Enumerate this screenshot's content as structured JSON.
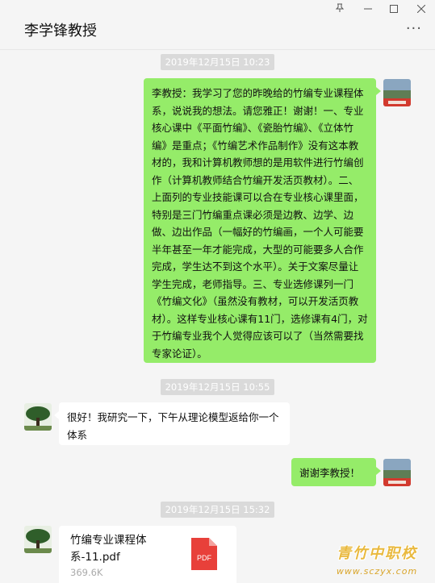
{
  "window": {
    "title": "李学锋教授",
    "pin_glyph": "ʼn",
    "minimize_glyph": "—",
    "maximize_glyph": "☐",
    "close_glyph": "✕",
    "more_glyph": "···"
  },
  "messages": [
    {
      "timestamp": "2019年12月15日 10:23",
      "sender": "self",
      "text": "李教授：我学习了您的昨晚给的竹编专业课程体系，说说我的想法。请您雅正！谢谢！一、专业核心课中《平面竹编》、《瓷胎竹编》、《立体竹编》是重点；《竹编艺术作品制作》没有这本教材的，我和计算机教师想的是用软件进行竹编创作（计算机教师结合竹编开发活页教材）。二、上面列的专业技能课可以合在专业核心课里面，特别是三门竹编重点课必须是边教、边学、边做、边出作品（一幅好的竹编画，一个人可能要半年甚至一年才能完成，大型的可能要多人合作完成，学生达不到这个水平）。关于文案尽量让学生完成，老师指导。三、专业选修课列一门《竹编文化》（虽然没有教材，可以开发活页教材）。这样专业核心课有11门，选修课有4门，对于竹编专业我个人觉得应该可以了（当然需要找专家论证）。"
    },
    {
      "timestamp": "2019年12月15日 10:55",
      "sender": "other",
      "text": "很好！我研究一下，下午从理论模型返给你一个体系"
    },
    {
      "sender": "self",
      "text": "谢谢李教授！"
    },
    {
      "timestamp": "2019年12月15日 15:32",
      "sender": "other",
      "file": {
        "name": "竹编专业课程体系-11.pdf",
        "size": "369.6K",
        "icon_label": "PDF"
      }
    }
  ],
  "watermark": {
    "title": "青竹中职校",
    "url": "www.sczyx.com"
  },
  "colors": {
    "self_bubble": "#95ec69",
    "other_bubble": "#ffffff",
    "pdf_red": "#e8403a",
    "background": "#f5f5f5"
  }
}
